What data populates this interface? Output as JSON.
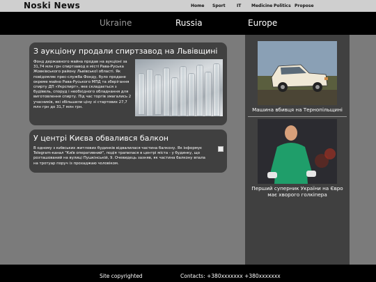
{
  "header": {
    "logo": "Noski News"
  },
  "top_nav": [
    "Home",
    "Sport",
    "IT",
    "Medicine",
    "Politics",
    "Propose"
  ],
  "sub_nav": [
    {
      "label": "Ukraine",
      "active": true
    },
    {
      "label": "Russia",
      "active": false
    },
    {
      "label": "Europe",
      "active": false
    }
  ],
  "articles": [
    {
      "title": "З аукціону продали спиртзавод на Львівщині",
      "text": "Фонд державного майна продав на аукціоні за 31,74 млн грн спиртзавод в місті Рава-Руська Жовківського району Львівської області. Як повідомляє прес-служба Фонду, було продане окреме майно Рава-Руського МПД та зберігання спирту ДП «Укрспирт», яке складається з будівель, споруд і необхідного обладнання для виготовлення спирту. Під час торгів змагались 2 учасників, які збільшили ціну зі стартових 27,7 млн грн до 31,7 млн грн."
    },
    {
      "title": "У центрі Києва обвалився балкон",
      "text": "В одному з київських житлових будинків відвалилася частина балкону. Як інформує Telegram-канал \"Київ оперативний\", подія трапилася в центрі міста - у будинку, що розташований на вулиці Пушкінській, 9. Очевидець зазняв, як частина балкону впала на тротуар поруч із прохаджаю чоловіком."
    }
  ],
  "sidebar": [
    {
      "caption": "Машина вбивця на Тернопільщині"
    },
    {
      "caption": "Перший суперник України на Євро має хворого голкіпера"
    }
  ],
  "footer": {
    "copyright": "Site copyrighted",
    "contacts": "Contacts: +380xxxxxxx +380xxxxxxx"
  },
  "colors": {
    "topbar": "#cfcfcf",
    "subnav": "#000000",
    "page_bg": "#7b7b7b",
    "card_bg": "#404040",
    "sidebar_bg": "#404040",
    "inactive_tab": "#9a9a9a"
  }
}
